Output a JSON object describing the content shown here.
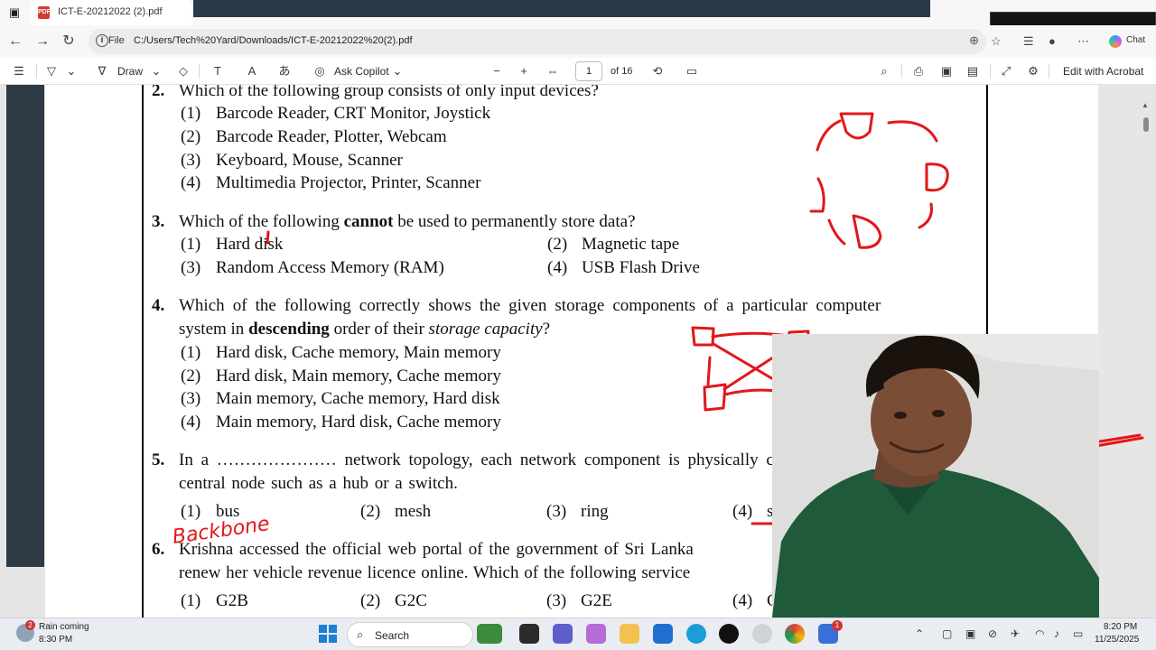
{
  "browser": {
    "tab_title": "ICT-E-20212022 (2).pdf",
    "file_label": "File",
    "url": "C:/Users/Tech%20Yard/Downloads/ICT-E-20212022%20(2).pdf",
    "chat_label": "Chat"
  },
  "toolbar": {
    "draw_label": "Draw",
    "copilot_label": "Ask Copilot",
    "page_number": "1",
    "page_total": "of 16",
    "edit_label": "Edit with Acrobat"
  },
  "questions": {
    "q2": {
      "num": "2.",
      "text": "Which of the following group consists of only input devices?",
      "options": [
        {
          "n": "(1)",
          "t": "Barcode Reader, CRT Monitor, Joystick"
        },
        {
          "n": "(2)",
          "t": "Barcode Reader, Plotter, Webcam"
        },
        {
          "n": "(3)",
          "t": "Keyboard, Mouse, Scanner"
        },
        {
          "n": "(4)",
          "t": "Multimedia Projector, Printer, Scanner"
        }
      ]
    },
    "q3": {
      "num": "3.",
      "text_a": "Which of the following",
      "text_bold": "cannot",
      "text_b": "be used to permanently store data?",
      "options": [
        {
          "n": "(1)",
          "t": "Hard disk"
        },
        {
          "n": "(2)",
          "t": "Magnetic tape"
        },
        {
          "n": "(3)",
          "t": "Random Access Memory (RAM)"
        },
        {
          "n": "(4)",
          "t": "USB Flash Drive"
        }
      ]
    },
    "q4": {
      "num": "4.",
      "line1": "Which of the following correctly shows the given storage components of a particular computer",
      "line2_a": "system in",
      "line2_bold": "descending",
      "line2_b": "order of their",
      "line2_italic": "storage capacity",
      "line2_c": "?",
      "options": [
        {
          "n": "(1)",
          "t": "Hard disk, Cache memory, Main memory"
        },
        {
          "n": "(2)",
          "t": "Hard disk, Main memory, Cache memory"
        },
        {
          "n": "(3)",
          "t": "Main memory, Cache memory, Hard disk"
        },
        {
          "n": "(4)",
          "t": "Main memory, Hard disk, Cache memory"
        }
      ]
    },
    "q5": {
      "num": "5.",
      "line1": "In a ………………… network topology, each network component is physically conn",
      "line2": "central node such as a hub or a switch.",
      "options": [
        {
          "n": "(1)",
          "t": "bus"
        },
        {
          "n": "(2)",
          "t": "mesh"
        },
        {
          "n": "(3)",
          "t": "ring"
        },
        {
          "n": "(4)",
          "t": "star"
        }
      ]
    },
    "q6": {
      "num": "6.",
      "line1": "Krishna accessed the official web portal of the government of Sri Lanka",
      "line2": "renew her vehicle revenue licence online. Which of the following service",
      "options": [
        {
          "n": "(1)",
          "t": "G2B"
        },
        {
          "n": "(2)",
          "t": "G2C"
        },
        {
          "n": "(3)",
          "t": "G2E"
        },
        {
          "n": "(4)",
          "t": "G"
        }
      ]
    }
  },
  "annotations": {
    "handwriting": "Backbone",
    "ink_color": "#e3161b"
  },
  "taskbar": {
    "weather_badge": "2",
    "weather_text": "Rain coming",
    "weather_time": "8:30 PM",
    "search_label": "Search",
    "clock_time": "8:20 PM",
    "clock_date": "11/25/2025",
    "app_badge": "1"
  }
}
